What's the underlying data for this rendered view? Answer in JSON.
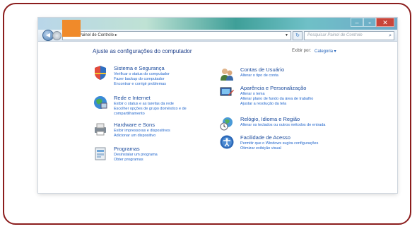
{
  "address": {
    "path": "Painel de Controle",
    "separator": "▸"
  },
  "search": {
    "placeholder": "Pesquisar Painel de Controle"
  },
  "main": {
    "heading": "Ajuste as configurações do computador",
    "view_label": "Exibir por:",
    "view_value": "Categoria ▾"
  },
  "categories": [
    {
      "title": "Sistema e Segurança",
      "links": [
        "Verificar o status do computador",
        "Fazer backup do computador",
        "Encontrar e corrigir problemas"
      ]
    },
    {
      "title": "Rede e Internet",
      "links": [
        "Exibir o status e as tarefas da rede",
        "Escolher opções de grupo doméstico e de",
        "compartilhamento"
      ]
    },
    {
      "title": "Hardware e Sons",
      "links": [
        "Exibir impressoras e dispositivos",
        "Adicionar um dispositivo"
      ]
    },
    {
      "title": "Programas",
      "links": [
        "Desinstalar um programa",
        "Obter programas"
      ]
    },
    {
      "title": "Contas de Usuário",
      "links": [
        "Alterar o tipo de conta"
      ]
    },
    {
      "title": "Aparência e Personalização",
      "links": [
        "Alterar o tema",
        "Alterar plano de fundo da área de trabalho",
        "Ajustar a resolução da tela"
      ]
    },
    {
      "title": "Relógio, Idioma e Região",
      "links": [
        "Alterar os teclados ou outros métodos de entrada"
      ]
    },
    {
      "title": "Facilidade de Acesso",
      "links": [
        "Permitir que o Windows sugira configurações",
        "Otimizar exibição visual"
      ]
    }
  ]
}
